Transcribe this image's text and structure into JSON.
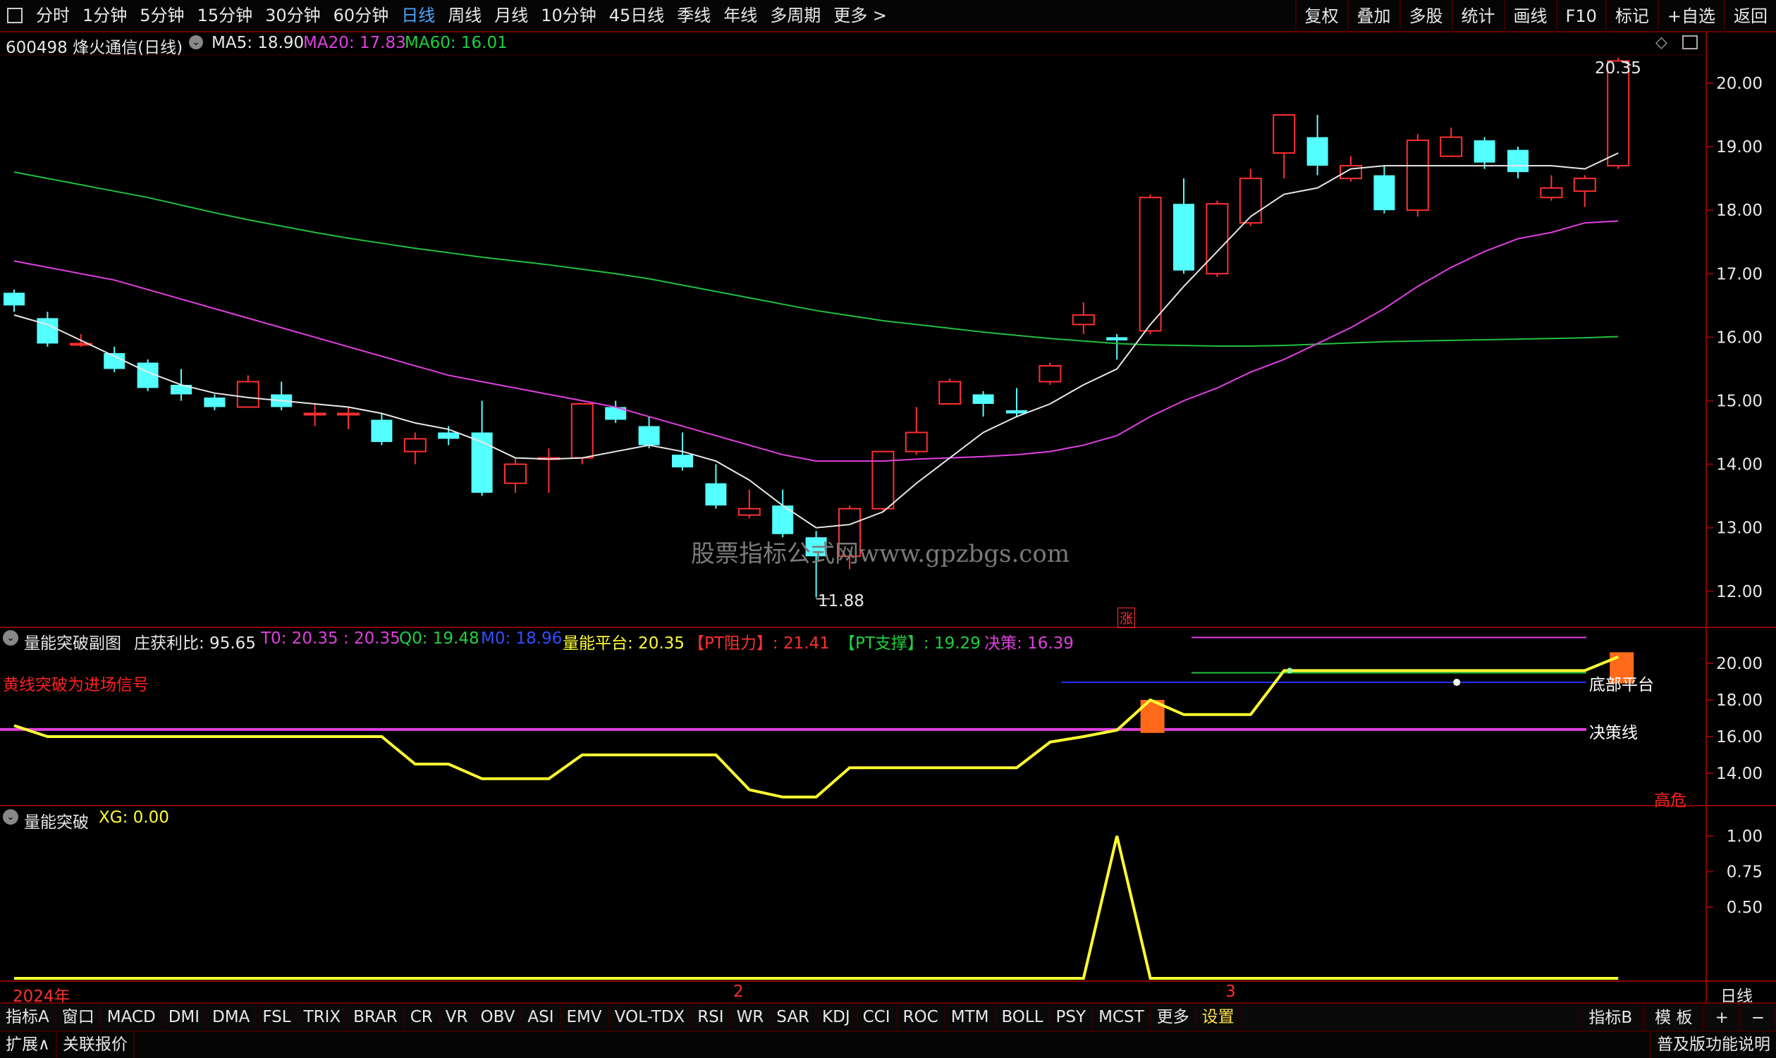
{
  "topbar": {
    "periods": [
      "分时",
      "1分钟",
      "5分钟",
      "15分钟",
      "30分钟",
      "60分钟",
      "日线",
      "周线",
      "月线",
      "10分钟",
      "45日线",
      "季线",
      "年线",
      "多周期",
      "更多 >"
    ],
    "active": "日线",
    "right_buttons": [
      "复权",
      "叠加",
      "多股",
      "统计",
      "画线",
      "F10",
      "标记",
      "+自选",
      "返回"
    ]
  },
  "main": {
    "stock": "600498 烽火通信(日线)",
    "ma5": "MA5: 18.90",
    "ma20": "MA20: 17.83",
    "ma60": "MA60: 16.01",
    "y_ticks": [
      "20.00",
      "19.00",
      "18.00",
      "17.00",
      "16.00",
      "15.00",
      "14.00",
      "13.00",
      "12.00"
    ],
    "high_label": "20.35",
    "low_label": "11.88",
    "watermark": "股票指标公式网www.gpzbgs.com",
    "zhang_badge": "涨"
  },
  "sub1": {
    "name": "量能突破副图",
    "zhuanghuo": "庄获利比: 95.65",
    "t0": "T0: 20.35 : 20.35",
    "q0": "Q0: 19.48",
    "m0": "M0: 18.96",
    "platform": "量能平台: 20.35",
    "pt_res": "【PT阻力】: 21.41",
    "pt_sup": "【PT支撑】: 19.29",
    "decision": "决策: 16.39",
    "hint": "黄线突破为进场信号",
    "label_bottom": "底部平台",
    "label_decision": "决策线",
    "label_danger": "高危",
    "y_ticks": [
      "20.00",
      "18.00",
      "16.00",
      "14.00"
    ]
  },
  "sub2": {
    "name": "量能突破",
    "xg": "XG: 0.00",
    "y_ticks": [
      "1.00",
      "0.75",
      "0.50"
    ]
  },
  "x_axis": {
    "year": "2024年",
    "m2": "2",
    "m3": "3",
    "period": "日线"
  },
  "bottombar": {
    "items": [
      "指标A",
      "窗口",
      "MACD",
      "DMI",
      "DMA",
      "FSL",
      "TRIX",
      "BRAR",
      "CR",
      "VR",
      "OBV",
      "ASI",
      "EMV",
      "VOL-TDX",
      "RSI",
      "WR",
      "SAR",
      "KDJ",
      "CCI",
      "ROC",
      "MTM",
      "BOLL",
      "PSY",
      "MCST",
      "更多",
      "设置"
    ],
    "right": [
      "指标B",
      "模 板",
      "+",
      "−"
    ]
  },
  "statusbar": {
    "left": [
      "扩展∧",
      "关联报价"
    ],
    "right": "普及版功能说明"
  },
  "colors": {
    "up": "#ff3030",
    "down": "#54ffff",
    "ma5": "#e8e8e8",
    "ma20": "#e040e0",
    "ma60": "#20c040",
    "yellow": "#ffff33"
  },
  "chart_data": {
    "type": "candlestick",
    "candles": [
      [
        16.7,
        16.5,
        16.75,
        16.4
      ],
      [
        16.3,
        15.9,
        16.4,
        15.85
      ],
      [
        15.9,
        15.9,
        16.05,
        15.85
      ],
      [
        15.75,
        15.5,
        15.85,
        15.45
      ],
      [
        15.6,
        15.2,
        15.65,
        15.15
      ],
      [
        15.25,
        15.1,
        15.5,
        15.0
      ],
      [
        15.05,
        14.9,
        15.1,
        14.85
      ],
      [
        14.9,
        15.3,
        15.4,
        14.9
      ],
      [
        15.1,
        14.9,
        15.3,
        14.85
      ],
      [
        14.8,
        14.8,
        14.95,
        14.6
      ],
      [
        14.8,
        14.8,
        14.9,
        14.55
      ],
      [
        14.7,
        14.35,
        14.8,
        14.3
      ],
      [
        14.2,
        14.4,
        14.5,
        14.0
      ],
      [
        14.5,
        14.4,
        14.6,
        14.3
      ],
      [
        14.5,
        13.55,
        15.0,
        13.5
      ],
      [
        13.7,
        14.0,
        14.1,
        13.55
      ],
      [
        14.1,
        14.1,
        14.25,
        13.55
      ],
      [
        14.1,
        14.95,
        14.95,
        14.0
      ],
      [
        14.9,
        14.7,
        15.0,
        14.65
      ],
      [
        14.6,
        14.3,
        14.75,
        14.25
      ],
      [
        14.15,
        13.95,
        14.5,
        13.9
      ],
      [
        13.7,
        13.35,
        14.0,
        13.3
      ],
      [
        13.2,
        13.3,
        13.6,
        13.15
      ],
      [
        13.35,
        12.9,
        13.6,
        12.85
      ],
      [
        12.85,
        12.55,
        12.95,
        11.9
      ],
      [
        12.55,
        13.3,
        13.35,
        12.35
      ],
      [
        13.3,
        14.2,
        14.2,
        13.25
      ],
      [
        14.2,
        14.5,
        14.9,
        14.15
      ],
      [
        14.95,
        15.3,
        15.35,
        14.95
      ],
      [
        15.1,
        14.95,
        15.15,
        14.75
      ],
      [
        14.85,
        14.8,
        15.2,
        14.75
      ],
      [
        15.3,
        15.55,
        15.6,
        15.25
      ],
      [
        16.2,
        16.35,
        16.55,
        16.05
      ],
      [
        16.0,
        15.95,
        16.05,
        15.65
      ],
      [
        16.1,
        18.2,
        18.25,
        16.05
      ],
      [
        18.1,
        17.05,
        18.5,
        17.0
      ],
      [
        17.0,
        18.1,
        18.15,
        16.95
      ],
      [
        17.8,
        18.5,
        18.65,
        17.75
      ],
      [
        18.9,
        19.5,
        19.5,
        18.5
      ],
      [
        19.15,
        18.7,
        19.5,
        18.55
      ],
      [
        18.5,
        18.7,
        18.85,
        18.45
      ],
      [
        18.55,
        18.0,
        18.7,
        17.95
      ],
      [
        18.0,
        19.1,
        19.2,
        17.9
      ],
      [
        18.85,
        19.15,
        19.3,
        18.85
      ],
      [
        19.1,
        18.75,
        19.15,
        18.65
      ],
      [
        18.95,
        18.6,
        19.0,
        18.5
      ],
      [
        18.2,
        18.35,
        18.55,
        18.15
      ],
      [
        18.3,
        18.5,
        18.55,
        18.05
      ],
      [
        18.7,
        20.35,
        20.4,
        18.65
      ]
    ],
    "ma5": [
      16.35,
      16.2,
      15.95,
      15.7,
      15.45,
      15.25,
      15.12,
      15.05,
      15.0,
      14.95,
      14.9,
      14.8,
      14.65,
      14.55,
      14.35,
      14.1,
      14.08,
      14.1,
      14.2,
      14.3,
      14.2,
      14.05,
      13.75,
      13.35,
      13.0,
      13.05,
      13.25,
      13.7,
      14.1,
      14.5,
      14.75,
      14.95,
      15.25,
      15.5,
      16.2,
      16.8,
      17.35,
      17.9,
      18.25,
      18.35,
      18.65,
      18.7,
      18.7,
      18.7,
      18.7,
      18.7,
      18.7,
      18.65,
      18.9
    ],
    "ma20": [
      17.2,
      17.1,
      17.0,
      16.9,
      16.75,
      16.6,
      16.45,
      16.3,
      16.15,
      16.0,
      15.85,
      15.7,
      15.55,
      15.4,
      15.3,
      15.2,
      15.1,
      15.0,
      14.9,
      14.75,
      14.6,
      14.45,
      14.3,
      14.15,
      14.05,
      14.05,
      14.05,
      14.08,
      14.1,
      14.12,
      14.15,
      14.2,
      14.3,
      14.45,
      14.75,
      15.0,
      15.2,
      15.45,
      15.65,
      15.9,
      16.15,
      16.45,
      16.8,
      17.1,
      17.35,
      17.55,
      17.65,
      17.8,
      17.83
    ],
    "ma60": [
      18.6,
      18.5,
      18.4,
      18.3,
      18.2,
      18.08,
      17.96,
      17.85,
      17.75,
      17.65,
      17.56,
      17.48,
      17.4,
      17.33,
      17.26,
      17.2,
      17.14,
      17.07,
      17.0,
      16.92,
      16.82,
      16.72,
      16.62,
      16.52,
      16.42,
      16.34,
      16.26,
      16.2,
      16.14,
      16.08,
      16.03,
      15.98,
      15.94,
      15.9,
      15.88,
      15.87,
      15.86,
      15.86,
      15.87,
      15.89,
      15.91,
      15.93,
      15.94,
      15.95,
      15.96,
      15.97,
      15.98,
      15.99,
      16.01
    ],
    "sub1_yellow": [
      16.6,
      16.0,
      16.0,
      16.0,
      16.0,
      16.0,
      16.0,
      16.0,
      16.0,
      16.0,
      16.0,
      16.0,
      14.5,
      14.5,
      13.7,
      13.7,
      13.7,
      15.0,
      15.0,
      15.0,
      15.0,
      15.0,
      13.1,
      12.7,
      12.7,
      14.3,
      14.3,
      14.3,
      14.3,
      14.3,
      14.3,
      15.7,
      16.0,
      16.35,
      18.0,
      17.2,
      17.2,
      17.2,
      19.6,
      19.6,
      19.6,
      19.6,
      19.6,
      19.6,
      19.6,
      19.6,
      19.6,
      19.6,
      20.35
    ],
    "sub1_decision": 16.39,
    "sub2_xg": [
      0,
      0,
      0,
      0,
      0,
      0,
      0,
      0,
      0,
      0,
      0,
      0,
      0,
      0,
      0,
      0,
      0,
      0,
      0,
      0,
      0,
      0,
      0,
      0,
      0,
      0,
      0,
      0,
      0,
      0,
      0,
      0,
      0,
      1,
      0,
      0,
      0,
      0,
      0,
      0,
      0,
      0,
      0,
      0,
      0,
      0,
      0,
      0,
      0
    ]
  }
}
